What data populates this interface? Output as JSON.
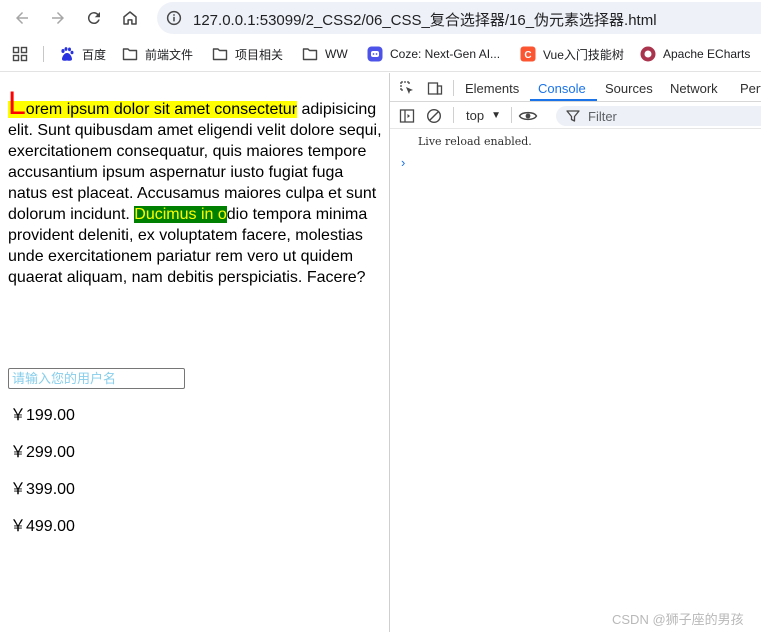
{
  "browser": {
    "url": "127.0.0.1:53099/2_CSS2/06_CSS_复合选择器/16_伪元素选择器.html"
  },
  "bookmarks": [
    {
      "label": "百度",
      "icon": "baidu-paw-icon",
      "color": "#2932e1"
    },
    {
      "label": "前端文件",
      "icon": "folder-icon"
    },
    {
      "label": "项目相关",
      "icon": "folder-icon"
    },
    {
      "label": "WW",
      "icon": "folder-icon"
    },
    {
      "label": "Coze: Next-Gen AI...",
      "icon": "coze-icon",
      "color": "#4d53e8"
    },
    {
      "label": "Vue入门技能树",
      "icon": "csdn-icon",
      "color": "#fc5531"
    },
    {
      "label": "Apache ECharts",
      "icon": "echarts-icon",
      "color": "#aa344d"
    }
  ],
  "page": {
    "first_letter": "L",
    "first_line_rest": "orem ipsum dolor sit amet consectetur",
    "text_before_selection": " adipisicing elit. Sunt quibusdam amet eligendi velit dolore sequi, exercitationem consequatur, quis maiores tempore accusantium ipsum aspernatur iusto fugiat fuga natus est placeat. Accusamus maiores culpa et sunt dolorum incidunt. ",
    "selected_text": "Ducimus in o",
    "text_after_selection": "dio tempora minima provident deleniti, ex voluptatem facere, molestias unde exercitationem pariatur rem vero ut quidem quaerat aliquam, nam debitis perspiciatis. Facere?",
    "input_placeholder": "请输入您的用户名",
    "input_value": "",
    "prices": [
      "￥199.00",
      "￥299.00",
      "￥399.00",
      "￥499.00"
    ],
    "colors": {
      "first_line_bg": "#ffff00",
      "first_letter": "#ff0000",
      "selection_bg": "#008000",
      "selection_text": "#ffff00",
      "placeholder": "#87ceeb"
    }
  },
  "devtools": {
    "tabs": [
      "Elements",
      "Console",
      "Sources",
      "Network",
      "Perf"
    ],
    "active_tab": "Console",
    "context": "top",
    "filter_placeholder": "Filter",
    "console_message": "Live reload enabled.",
    "prompt_symbol": "›"
  },
  "watermark": "CSDN @狮子座的男孩"
}
